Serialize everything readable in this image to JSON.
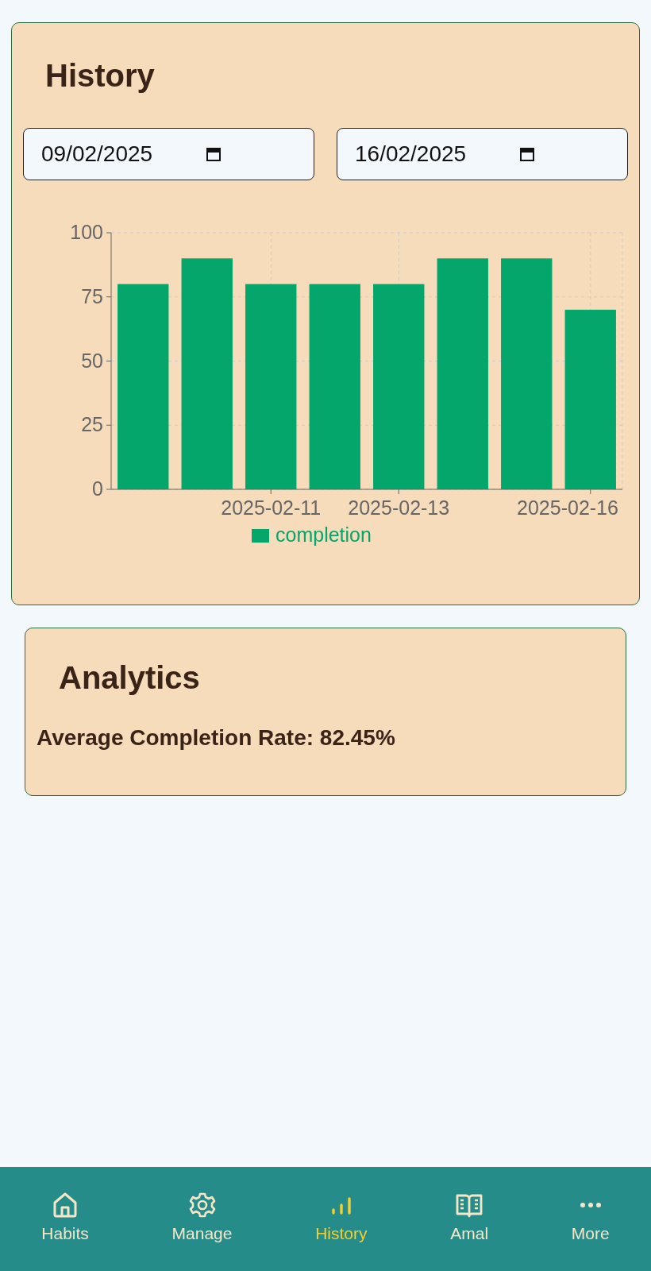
{
  "history": {
    "title": "History",
    "start_date": {
      "value": "09/02/2025"
    },
    "end_date": {
      "value": "16/02/2025"
    },
    "chart_data": {
      "type": "bar",
      "categories": [
        null,
        null,
        "2025-02-11",
        null,
        "2025-02-13",
        null,
        null,
        "2025-02-16"
      ],
      "grid": true,
      "series": [
        {
          "name": "completion",
          "color": "#05a66b",
          "values": [
            80,
            90,
            80,
            80,
            80,
            90,
            90,
            70
          ]
        }
      ],
      "ylim": [
        0,
        100
      ],
      "yticks": [
        0,
        25,
        50,
        75,
        100
      ]
    }
  },
  "analytics": {
    "title": "Analytics",
    "average": "Average Completion Rate: 82.45%"
  },
  "nav": [
    {
      "label": "Habits",
      "selected": false
    },
    {
      "label": "Manage",
      "selected": false
    },
    {
      "label": "History",
      "selected": true
    },
    {
      "label": "Amal",
      "selected": false
    },
    {
      "label": "More",
      "selected": false
    }
  ]
}
